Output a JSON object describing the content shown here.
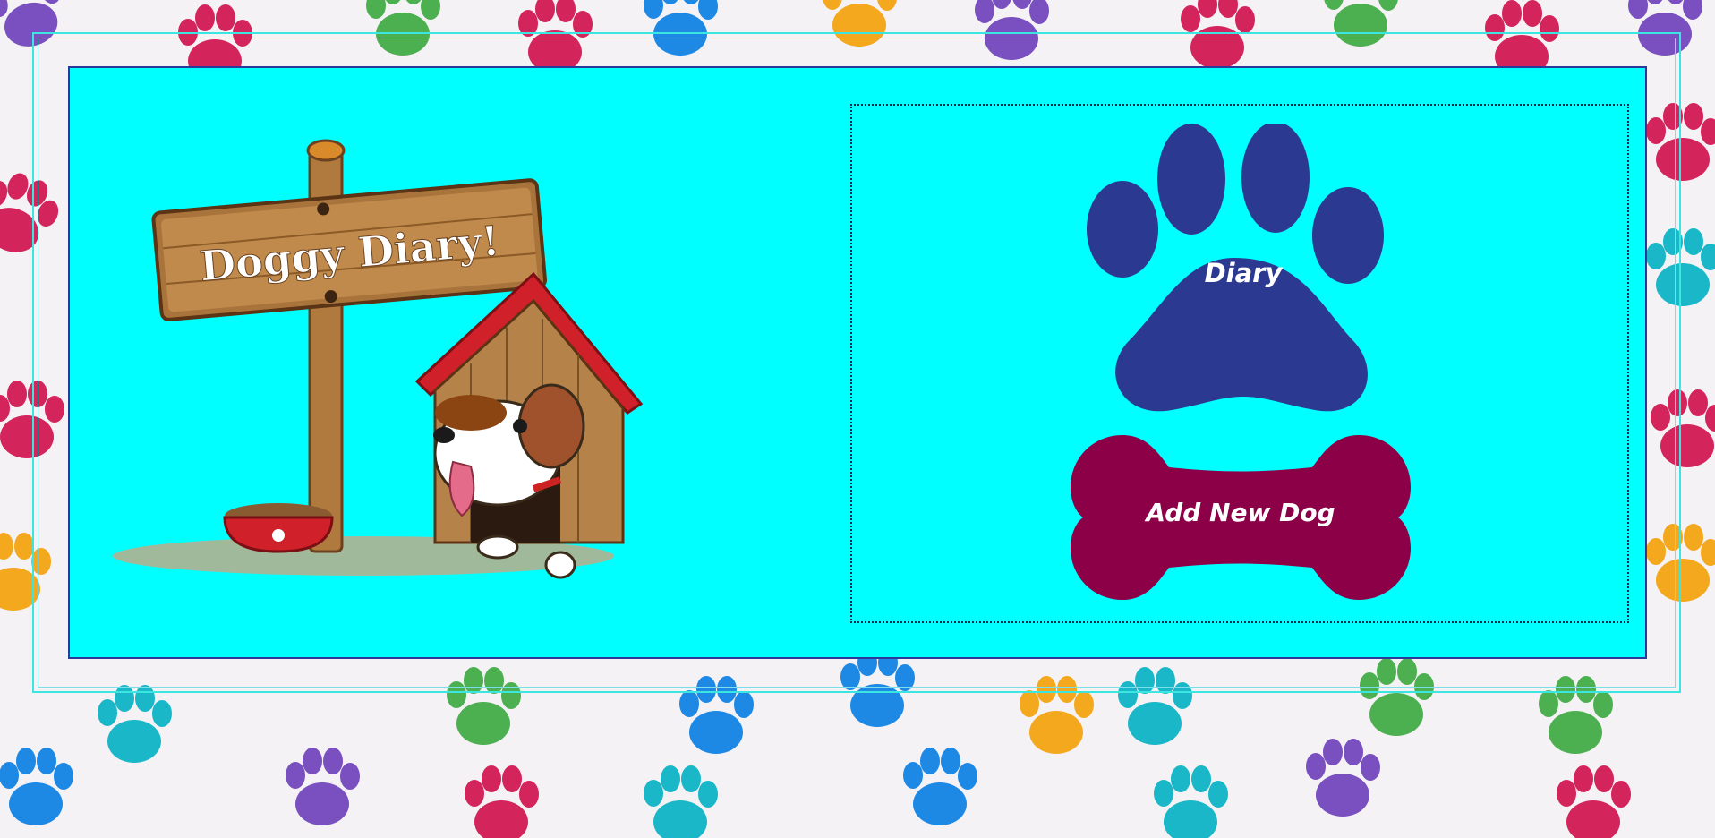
{
  "app": {
    "logo_text": "Doggy Diary!"
  },
  "nav": {
    "diary_label": "Diary",
    "add_dog_label": "Add New Dog"
  },
  "colors": {
    "panel_background": "#00ffff",
    "paw_button": "#2b3990",
    "bone_button": "#8b0046",
    "button_text": "#ffffff",
    "frame_border": "#2b3a9a"
  },
  "icons": {
    "background": "paw-print-pattern",
    "logo": "doghouse-sign-illustration",
    "diary": "paw-print-icon",
    "add_dog": "bone-icon"
  }
}
